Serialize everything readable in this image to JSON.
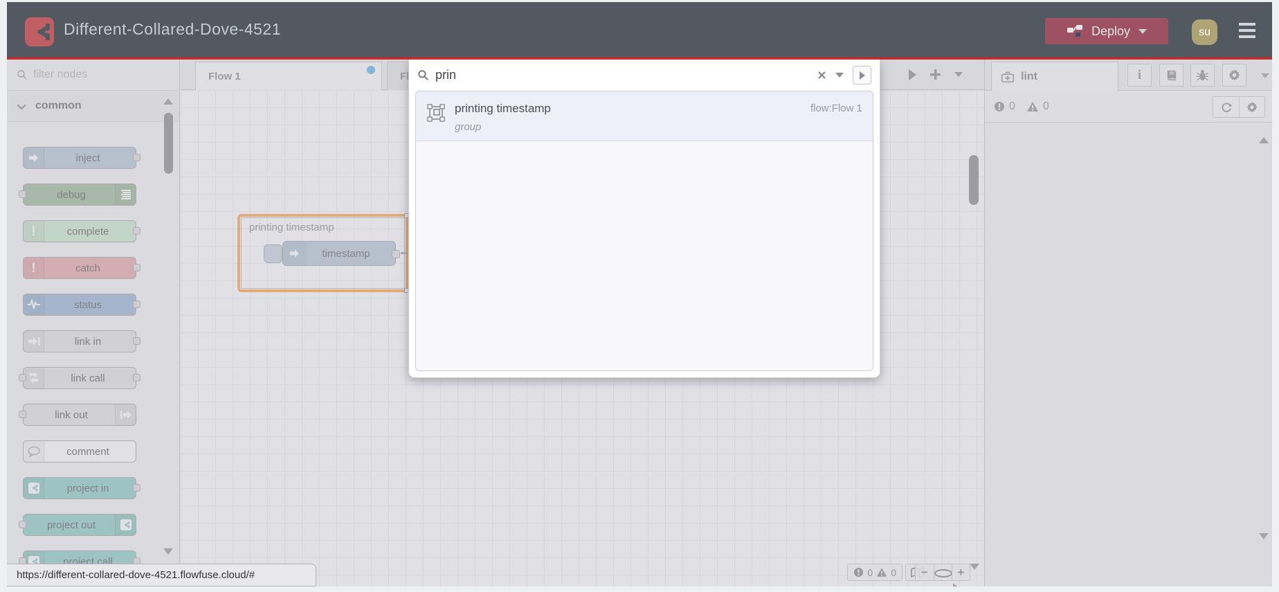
{
  "header": {
    "title": "Different-Collared-Dove-4521",
    "deploy_label": "Deploy",
    "avatar_initials": "su"
  },
  "palette": {
    "filter_placeholder": "filter nodes",
    "category": "common",
    "nodes": [
      {
        "label": "inject",
        "color": "#a6bbcf",
        "icon": "arrow-in-icon",
        "ports": "right"
      },
      {
        "label": "debug",
        "color": "#87a980",
        "icon": "debug-levels-icon",
        "ports": "left"
      },
      {
        "label": "complete",
        "color": "#c0e5c0",
        "icon": "exclamation-icon",
        "ports": "right"
      },
      {
        "label": "catch",
        "color": "#e49191",
        "icon": "exclamation-icon",
        "ports": "right"
      },
      {
        "label": "status",
        "color": "#7fa4c9",
        "icon": "pulse-icon",
        "ports": "right"
      },
      {
        "label": "link in",
        "color": "#dddddd",
        "icon": "link-in-icon",
        "ports": "right"
      },
      {
        "label": "link call",
        "color": "#dddddd",
        "icon": "link-call-icon",
        "ports": "both"
      },
      {
        "label": "link out",
        "color": "#dddddd",
        "icon": "link-out-icon",
        "ports": "left"
      },
      {
        "label": "comment",
        "color": "#ffffff",
        "icon": "comment-bubble-icon",
        "ports": "none"
      },
      {
        "label": "project in",
        "color": "#6fc0b4",
        "icon": "flowfuse-icon",
        "ports": "right"
      },
      {
        "label": "project out",
        "color": "#6fc0b4",
        "icon": "flowfuse-icon",
        "ports": "left"
      },
      {
        "label": "project call",
        "color": "#6fc0b4",
        "icon": "flowfuse-icon",
        "ports": "both"
      }
    ]
  },
  "workspace": {
    "tabs": [
      {
        "label": "Flow 1",
        "modified": true
      },
      {
        "label": "Fl"
      }
    ],
    "group": {
      "label": "printing timestamp",
      "node_label": "timestamp"
    }
  },
  "search": {
    "value": "prin",
    "results": [
      {
        "name": "printing timestamp",
        "type": "group",
        "flow": "flow:Flow 1"
      }
    ]
  },
  "sidebar": {
    "tab_label": "lint",
    "error_count": "0",
    "warning_count": "0"
  },
  "canvas_footer": {
    "error_count": "0",
    "warning_count": "0",
    "zoom_out": "−",
    "zoom_in": "+"
  },
  "statusbar": {
    "url": "https://different-collared-dove-4521.flowfuse.cloud/#"
  },
  "colors": {
    "header_bg": "#525960",
    "header_accent_line": "#d32424",
    "deploy_button": "#9e5160",
    "avatar_bg": "#b0a376",
    "logo_bg": "#c05f63",
    "selected_group_border": "#ff8c21",
    "modified_tab_dot": "#35a2dd",
    "flowfuse_teal": "#6fc0b4",
    "shade_overlay": "rgba(198,198,206,0.53)"
  }
}
